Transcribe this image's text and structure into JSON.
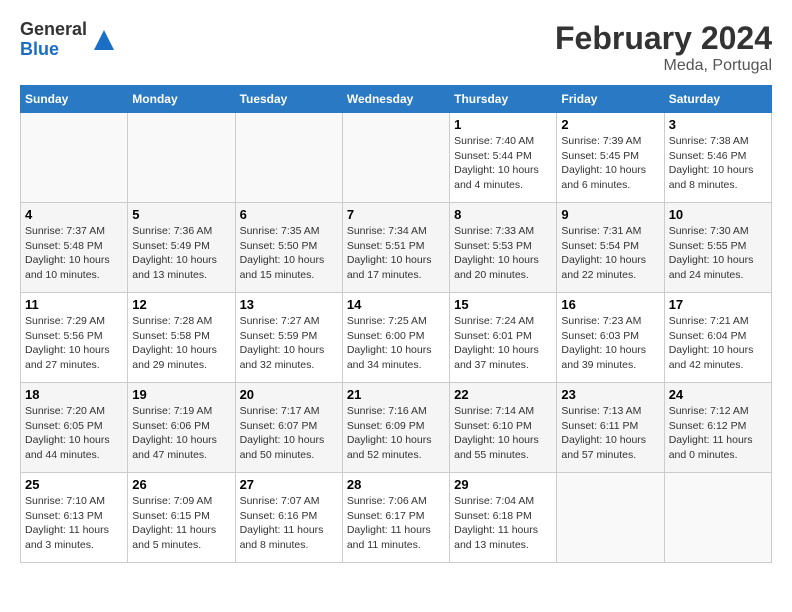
{
  "header": {
    "logo_general": "General",
    "logo_blue": "Blue",
    "month_title": "February 2024",
    "location": "Meda, Portugal"
  },
  "days_of_week": [
    "Sunday",
    "Monday",
    "Tuesday",
    "Wednesday",
    "Thursday",
    "Friday",
    "Saturday"
  ],
  "weeks": [
    [
      {
        "day": "",
        "empty": true
      },
      {
        "day": "",
        "empty": true
      },
      {
        "day": "",
        "empty": true
      },
      {
        "day": "",
        "empty": true
      },
      {
        "day": "1",
        "sunrise": "Sunrise: 7:40 AM",
        "sunset": "Sunset: 5:44 PM",
        "daylight": "Daylight: 10 hours and 4 minutes."
      },
      {
        "day": "2",
        "sunrise": "Sunrise: 7:39 AM",
        "sunset": "Sunset: 5:45 PM",
        "daylight": "Daylight: 10 hours and 6 minutes."
      },
      {
        "day": "3",
        "sunrise": "Sunrise: 7:38 AM",
        "sunset": "Sunset: 5:46 PM",
        "daylight": "Daylight: 10 hours and 8 minutes."
      }
    ],
    [
      {
        "day": "4",
        "sunrise": "Sunrise: 7:37 AM",
        "sunset": "Sunset: 5:48 PM",
        "daylight": "Daylight: 10 hours and 10 minutes."
      },
      {
        "day": "5",
        "sunrise": "Sunrise: 7:36 AM",
        "sunset": "Sunset: 5:49 PM",
        "daylight": "Daylight: 10 hours and 13 minutes."
      },
      {
        "day": "6",
        "sunrise": "Sunrise: 7:35 AM",
        "sunset": "Sunset: 5:50 PM",
        "daylight": "Daylight: 10 hours and 15 minutes."
      },
      {
        "day": "7",
        "sunrise": "Sunrise: 7:34 AM",
        "sunset": "Sunset: 5:51 PM",
        "daylight": "Daylight: 10 hours and 17 minutes."
      },
      {
        "day": "8",
        "sunrise": "Sunrise: 7:33 AM",
        "sunset": "Sunset: 5:53 PM",
        "daylight": "Daylight: 10 hours and 20 minutes."
      },
      {
        "day": "9",
        "sunrise": "Sunrise: 7:31 AM",
        "sunset": "Sunset: 5:54 PM",
        "daylight": "Daylight: 10 hours and 22 minutes."
      },
      {
        "day": "10",
        "sunrise": "Sunrise: 7:30 AM",
        "sunset": "Sunset: 5:55 PM",
        "daylight": "Daylight: 10 hours and 24 minutes."
      }
    ],
    [
      {
        "day": "11",
        "sunrise": "Sunrise: 7:29 AM",
        "sunset": "Sunset: 5:56 PM",
        "daylight": "Daylight: 10 hours and 27 minutes."
      },
      {
        "day": "12",
        "sunrise": "Sunrise: 7:28 AM",
        "sunset": "Sunset: 5:58 PM",
        "daylight": "Daylight: 10 hours and 29 minutes."
      },
      {
        "day": "13",
        "sunrise": "Sunrise: 7:27 AM",
        "sunset": "Sunset: 5:59 PM",
        "daylight": "Daylight: 10 hours and 32 minutes."
      },
      {
        "day": "14",
        "sunrise": "Sunrise: 7:25 AM",
        "sunset": "Sunset: 6:00 PM",
        "daylight": "Daylight: 10 hours and 34 minutes."
      },
      {
        "day": "15",
        "sunrise": "Sunrise: 7:24 AM",
        "sunset": "Sunset: 6:01 PM",
        "daylight": "Daylight: 10 hours and 37 minutes."
      },
      {
        "day": "16",
        "sunrise": "Sunrise: 7:23 AM",
        "sunset": "Sunset: 6:03 PM",
        "daylight": "Daylight: 10 hours and 39 minutes."
      },
      {
        "day": "17",
        "sunrise": "Sunrise: 7:21 AM",
        "sunset": "Sunset: 6:04 PM",
        "daylight": "Daylight: 10 hours and 42 minutes."
      }
    ],
    [
      {
        "day": "18",
        "sunrise": "Sunrise: 7:20 AM",
        "sunset": "Sunset: 6:05 PM",
        "daylight": "Daylight: 10 hours and 44 minutes."
      },
      {
        "day": "19",
        "sunrise": "Sunrise: 7:19 AM",
        "sunset": "Sunset: 6:06 PM",
        "daylight": "Daylight: 10 hours and 47 minutes."
      },
      {
        "day": "20",
        "sunrise": "Sunrise: 7:17 AM",
        "sunset": "Sunset: 6:07 PM",
        "daylight": "Daylight: 10 hours and 50 minutes."
      },
      {
        "day": "21",
        "sunrise": "Sunrise: 7:16 AM",
        "sunset": "Sunset: 6:09 PM",
        "daylight": "Daylight: 10 hours and 52 minutes."
      },
      {
        "day": "22",
        "sunrise": "Sunrise: 7:14 AM",
        "sunset": "Sunset: 6:10 PM",
        "daylight": "Daylight: 10 hours and 55 minutes."
      },
      {
        "day": "23",
        "sunrise": "Sunrise: 7:13 AM",
        "sunset": "Sunset: 6:11 PM",
        "daylight": "Daylight: 10 hours and 57 minutes."
      },
      {
        "day": "24",
        "sunrise": "Sunrise: 7:12 AM",
        "sunset": "Sunset: 6:12 PM",
        "daylight": "Daylight: 11 hours and 0 minutes."
      }
    ],
    [
      {
        "day": "25",
        "sunrise": "Sunrise: 7:10 AM",
        "sunset": "Sunset: 6:13 PM",
        "daylight": "Daylight: 11 hours and 3 minutes."
      },
      {
        "day": "26",
        "sunrise": "Sunrise: 7:09 AM",
        "sunset": "Sunset: 6:15 PM",
        "daylight": "Daylight: 11 hours and 5 minutes."
      },
      {
        "day": "27",
        "sunrise": "Sunrise: 7:07 AM",
        "sunset": "Sunset: 6:16 PM",
        "daylight": "Daylight: 11 hours and 8 minutes."
      },
      {
        "day": "28",
        "sunrise": "Sunrise: 7:06 AM",
        "sunset": "Sunset: 6:17 PM",
        "daylight": "Daylight: 11 hours and 11 minutes."
      },
      {
        "day": "29",
        "sunrise": "Sunrise: 7:04 AM",
        "sunset": "Sunset: 6:18 PM",
        "daylight": "Daylight: 11 hours and 13 minutes."
      },
      {
        "day": "",
        "empty": true
      },
      {
        "day": "",
        "empty": true
      }
    ]
  ]
}
